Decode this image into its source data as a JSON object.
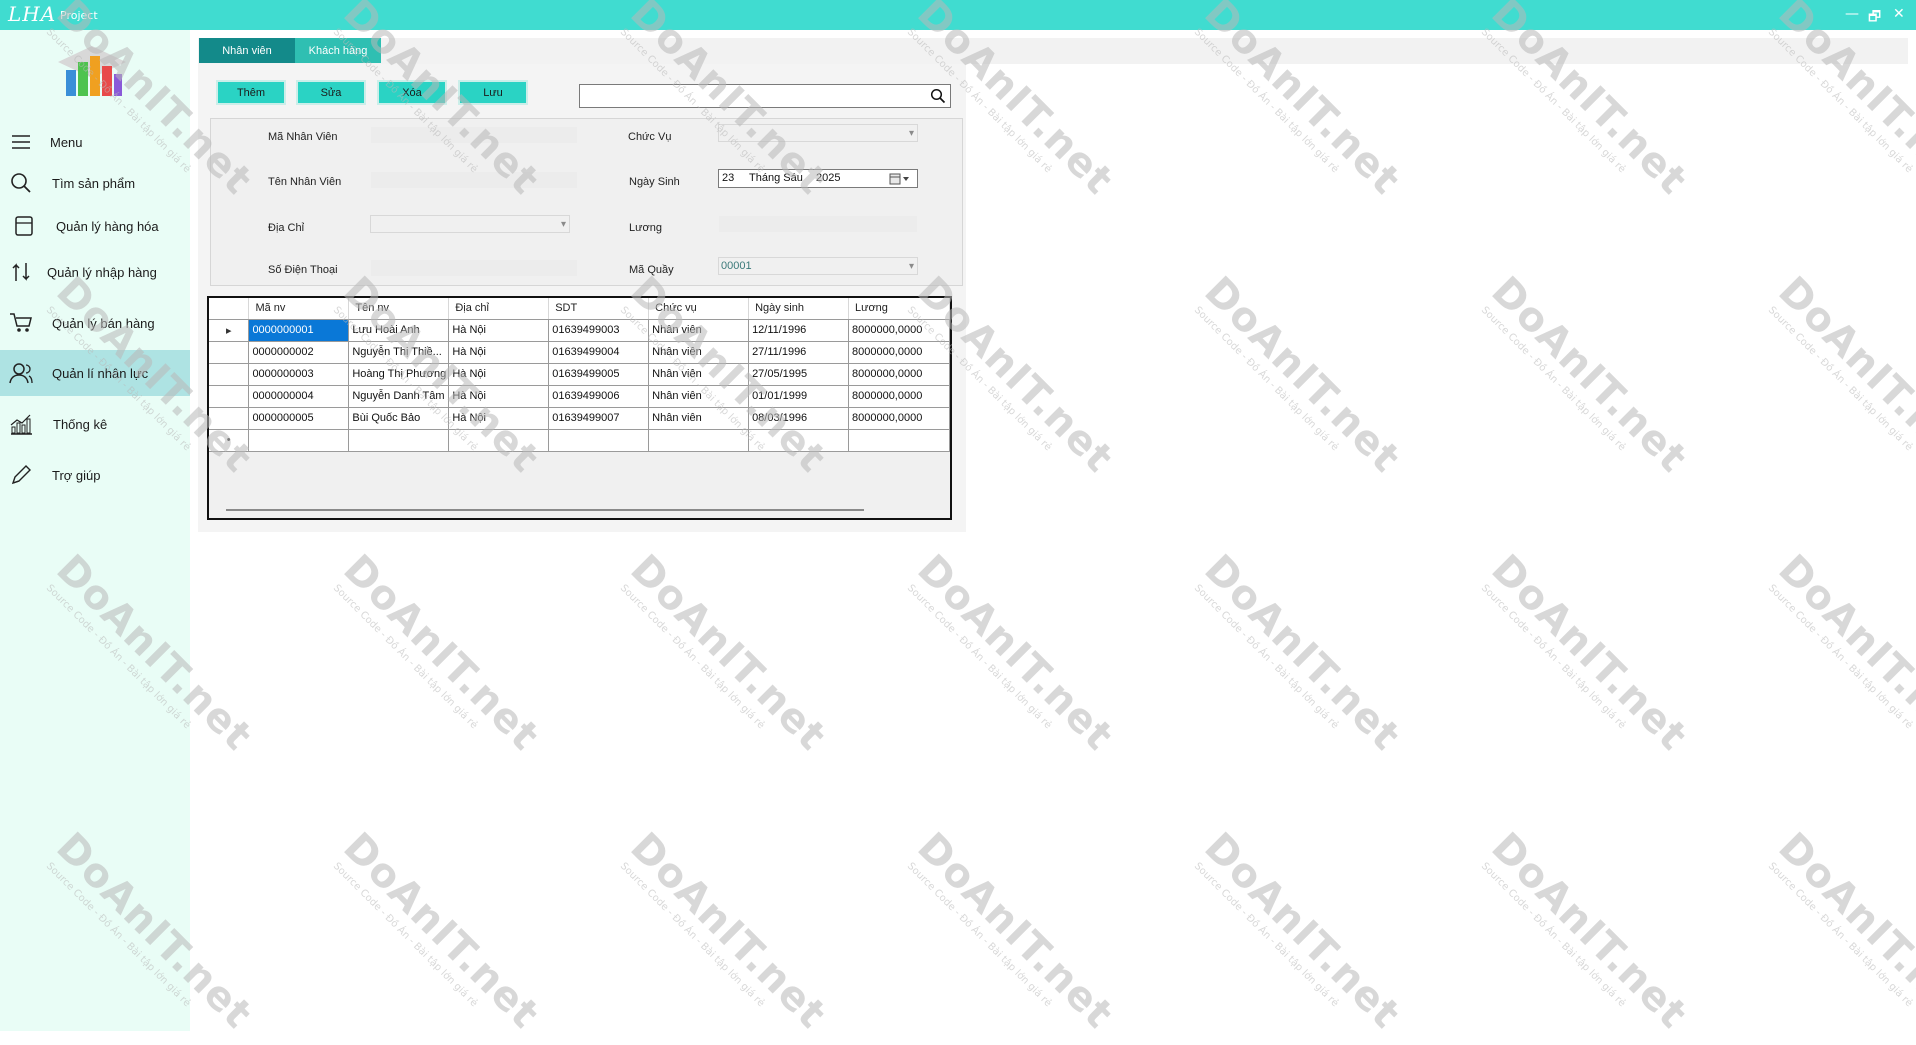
{
  "titlebar": {
    "brand": "LHA",
    "subtitle": "Project",
    "minimize": "—",
    "restore": "🗗",
    "close": "✕"
  },
  "sidebar": {
    "items": [
      {
        "label": "Menu",
        "icon": "hamburger-icon"
      },
      {
        "label": "Tìm sản phẩm",
        "icon": "search-icon"
      },
      {
        "label": "Quản lý hàng hóa",
        "icon": "box-icon"
      },
      {
        "label": "Quản lý nhập hàng",
        "icon": "import-icon"
      },
      {
        "label": "Quản lý bán hàng",
        "icon": "cart-icon"
      },
      {
        "label": "Quản lí nhân lực",
        "icon": "users-icon"
      },
      {
        "label": "Thống kê",
        "icon": "chart-icon"
      },
      {
        "label": "Trợ giúp",
        "icon": "pencil-icon"
      }
    ]
  },
  "tabs": {
    "employee": "Nhân viên",
    "customer": "Khách hàng"
  },
  "toolbar": {
    "add": "Thêm",
    "edit": "Sửa",
    "delete": "Xóa",
    "save": "Lưu"
  },
  "search": {
    "value": ""
  },
  "form": {
    "emp_id_label": "Mã Nhân Viên",
    "emp_name_label": "Tên Nhân Viên",
    "address_label": "Địa Chỉ",
    "phone_label": "Số Điện Thoại",
    "position_label": "Chức Vụ",
    "dob_label": "Ngày Sinh",
    "salary_label": "Lương",
    "counter_label": "Mã Quầy",
    "dob_day": "23",
    "dob_month": "Tháng Sáu",
    "dob_year": "2025",
    "counter_value": "00001"
  },
  "grid": {
    "columns": [
      "Mã nv",
      "Tên nv",
      "Địa chỉ",
      "SDT",
      "Chức vụ",
      "Ngày sinh",
      "Lương"
    ],
    "rows": [
      [
        "0000000001",
        "Lưu Hoài Anh",
        "Hà Nội",
        "01639499003",
        "Nhân viên",
        "12/11/1996",
        "8000000,0000"
      ],
      [
        "0000000002",
        "Nguyễn Thị Thiề...",
        "Hà Nội",
        "01639499004",
        "Nhân viên",
        "27/11/1996",
        "8000000,0000"
      ],
      [
        "0000000003",
        "Hoàng Thị Phương",
        "Hà Nội",
        "01639499005",
        "Nhân viên",
        "27/05/1995",
        "8000000,0000"
      ],
      [
        "0000000004",
        "Nguyễn Danh Tâm",
        "Hà Nội",
        "01639499006",
        "Nhân viên",
        "01/01/1999",
        "8000000,0000"
      ],
      [
        "0000000005",
        "Bùi Quốc Bảo",
        "Hà Nội",
        "01639499007",
        "Nhân viên",
        "08/03/1996",
        "8000000,0000"
      ]
    ],
    "current_row_marker": "▸",
    "new_row_marker": "•"
  },
  "watermark": {
    "brand": "DoAnIT.net",
    "tagline": "Source Code - Đồ Án - Bài tập lớn giá rẻ"
  },
  "colors": {
    "titlebar": "#40dcd0",
    "sidebar": "#e9fdf6",
    "active_nav": "#aee3e3",
    "tab_active": "#138a8a",
    "tab_inactive": "#2fbfb2",
    "button": "#2ad3c4",
    "selection": "#0a78d7"
  }
}
